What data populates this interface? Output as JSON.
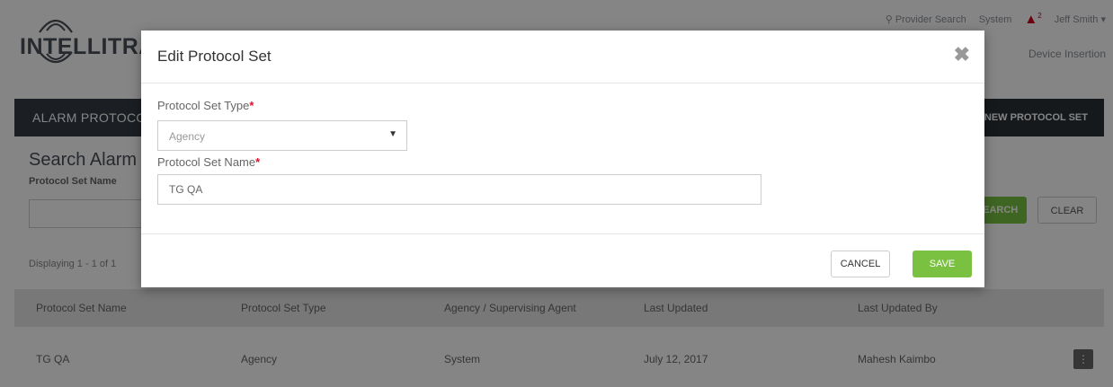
{
  "header": {
    "logo_text_bold": "INTELLITRAC",
    "provider_search": "Provider Search",
    "system": "System",
    "notification_count": "2",
    "user": "Jeff Smith",
    "subnav": "Device Insertion"
  },
  "titlebar": {
    "title": "ALARM PROTOCOL SETS",
    "new_button": "+ NEW PROTOCOL SET"
  },
  "search": {
    "title": "Search Alarm Protocol Sets",
    "label": "Protocol Set Name",
    "search_button": "SEARCH",
    "clear_button": "CLEAR",
    "displaying": "Displaying 1 - 1 of 1"
  },
  "table": {
    "headers": [
      "Protocol Set Name",
      "Protocol Set Type",
      "Agency / Supervising Agent",
      "Last Updated",
      "Last Updated By"
    ],
    "rows": [
      [
        "TG QA",
        "Agency",
        "System",
        "July 12, 2017",
        "Mahesh Kaimbo"
      ]
    ]
  },
  "modal": {
    "title": "Edit Protocol Set",
    "type_label": "Protocol Set Type",
    "type_value": "Agency",
    "name_label": "Protocol Set Name",
    "name_value": "TG QA",
    "required_mark": "*",
    "cancel_label": "CANCEL",
    "save_label": "SAVE"
  },
  "colors": {
    "accent_green": "#7ac142",
    "required_red": "#e0102b",
    "titlebar_dark": "#353b43"
  },
  "icons": [
    "search-icon",
    "bell-icon",
    "chevron-down-icon",
    "close-icon",
    "row-menu-icon",
    "logo-icon"
  ]
}
